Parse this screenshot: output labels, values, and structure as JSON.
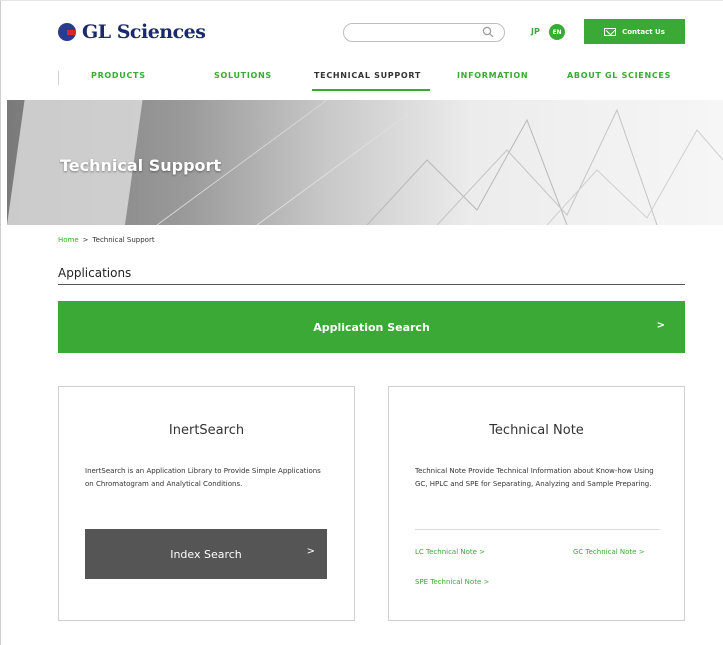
{
  "header": {
    "logo_text": "GL Sciences",
    "search": {
      "placeholder": "",
      "icon": "search-icon"
    },
    "lang_jp": "JP",
    "lang_en": "EN",
    "contact_label": "Contact Us"
  },
  "nav": {
    "items": [
      {
        "label": "PRODUCTS",
        "active": false
      },
      {
        "label": "SOLUTIONS",
        "active": false
      },
      {
        "label": "TECHNICAL SUPPORT",
        "active": true
      },
      {
        "label": "INFORMATION",
        "active": false
      },
      {
        "label": "ABOUT GL SCIENCES",
        "active": false
      }
    ]
  },
  "hero": {
    "title": "Technical Support"
  },
  "breadcrumb": {
    "home": "Home",
    "separator": ">",
    "current": "Technical Support"
  },
  "applications": {
    "heading": "Applications",
    "search_button": "Application Search",
    "chevron": ">"
  },
  "cards": {
    "inert": {
      "title": "InertSearch",
      "description": "InertSearch is an Application Library to Provide Simple Applications on Chromatogram and Analytical Conditions.",
      "button": "Index Search",
      "chevron": ">"
    },
    "technical": {
      "title": "Technical Note",
      "description": "Technical Note Provide Technical Information about Know-how Using GC, HPLC and SPE for Separating, Analyzing and Sample Preparing.",
      "links": [
        "LC Technical Note >",
        "GC Technical Note >",
        "SPE Technical Note >"
      ]
    }
  },
  "colors": {
    "accent": "#3aa935",
    "dark_button": "#555555",
    "logo_blue": "#1b2a6b",
    "logo_red": "#d8262e"
  }
}
